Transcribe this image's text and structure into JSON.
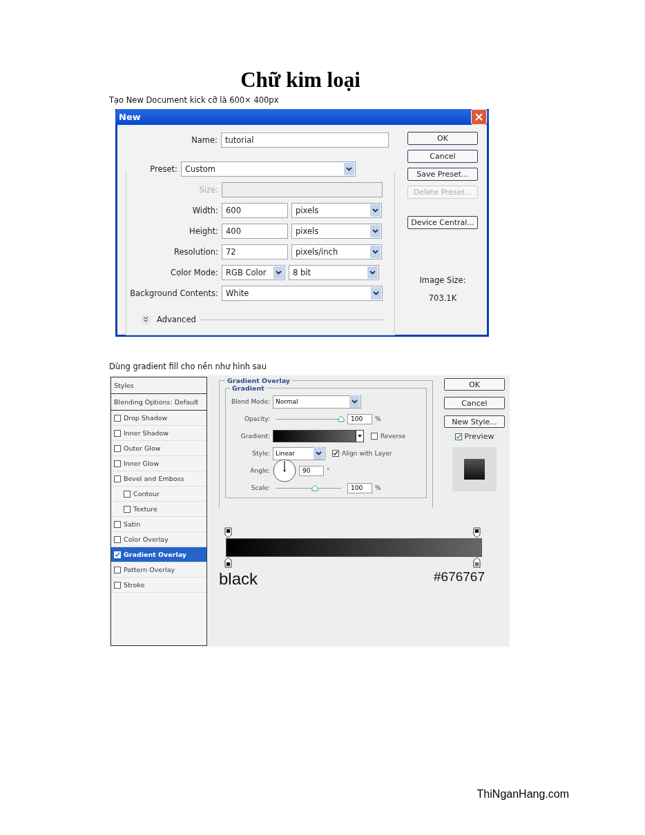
{
  "title": "Chữ kim loại",
  "caption_1": "Tạo New Document kick cỡ là 600× 400px",
  "new_dialog": {
    "title": "New",
    "fields": [
      {
        "kind": "text",
        "label": "Name:",
        "value": "tutorial",
        "disabled": false
      },
      {
        "kind": "select",
        "label": "Preset:",
        "value": "Custom",
        "disabled": false
      },
      {
        "kind": "select",
        "label": "Size:",
        "disabled": true
      },
      {
        "kind": "text_unit",
        "label": "Width:",
        "value": "600",
        "unit": "pixels",
        "disabled": false
      },
      {
        "kind": "text_unit",
        "label": "Height:",
        "value": "400",
        "unit": "pixels",
        "disabled": false
      },
      {
        "kind": "text_unit",
        "label": "Resolution:",
        "value": "72",
        "unit": "pixels/inch",
        "disabled": false
      },
      {
        "kind": "select_pair",
        "label": "Color Mode:",
        "value": "RGB Color",
        "unit": "8 bit",
        "disabled": false
      },
      {
        "kind": "select",
        "label": "Background Contents:",
        "value": "White",
        "disabled": false
      }
    ],
    "advanced": {
      "label": "Advanced",
      "expanded": false
    },
    "buttons": [
      {
        "label": "OK",
        "disabled": false
      },
      {
        "label": "Cancel",
        "disabled": false
      },
      {
        "label": "Save Preset...",
        "disabled": false
      },
      {
        "label": "Delete Preset...",
        "disabled": true
      },
      {
        "label": "Device Central...",
        "disabled": false
      }
    ],
    "image_size": {
      "label": "Image Size:",
      "value": "703.1K"
    }
  },
  "caption_2": "Dùng gradient fill cho nền như hình sau",
  "layer_style": {
    "styles": [
      {
        "kind": "header",
        "label": "Styles",
        "selected": false
      },
      {
        "kind": "header",
        "label": "Blending Options: Default",
        "selected": false
      },
      {
        "kind": "effect",
        "label": "Drop Shadow",
        "checked": false,
        "selected": false
      },
      {
        "kind": "effect",
        "label": "Inner Shadow",
        "checked": false,
        "selected": false
      },
      {
        "kind": "effect",
        "label": "Outer Glow",
        "checked": false,
        "selected": false
      },
      {
        "kind": "effect",
        "label": "Inner Glow",
        "checked": false,
        "selected": false
      },
      {
        "kind": "effect",
        "label": "Bevel and Emboss",
        "checked": false,
        "selected": false,
        "children": [
          {
            "kind": "effect",
            "label": "Contour",
            "checked": false,
            "selected": false
          },
          {
            "kind": "effect",
            "label": "Texture",
            "checked": false,
            "selected": false
          }
        ]
      },
      {
        "kind": "effect",
        "label": "Satin",
        "checked": false,
        "selected": false
      },
      {
        "kind": "effect",
        "label": "Color Overlay",
        "checked": false,
        "selected": false
      },
      {
        "kind": "effect",
        "label": "Gradient Overlay",
        "checked": true,
        "selected": true
      },
      {
        "kind": "effect",
        "label": "Pattern Overlay",
        "checked": false,
        "selected": false
      },
      {
        "kind": "effect",
        "label": "Stroke",
        "checked": false,
        "selected": false
      }
    ],
    "section": "Gradient Overlay",
    "subsection": "Gradient",
    "blend_mode": {
      "label": "Blend Mode:",
      "value": "Normal"
    },
    "opacity": {
      "label": "Opacity:",
      "level": 1,
      "value": "100",
      "unit": "%"
    },
    "gradient": {
      "label": "Gradient:",
      "reverse": {
        "label": "Reverse",
        "checked": false
      }
    },
    "style": {
      "label": "Style:",
      "value": "Linear",
      "align": {
        "label": "Align with Layer",
        "checked": true
      }
    },
    "angle": {
      "label": "Angle:",
      "value": "90",
      "unit": "°"
    },
    "scale": {
      "label": "Scale:",
      "level": 0.6,
      "value": "100",
      "unit": "%"
    },
    "buttons": [
      "OK",
      "Cancel",
      "New Style..."
    ],
    "preview": {
      "label": "Preview",
      "checked": true
    },
    "stops": [
      {
        "label": "black",
        "color": "#000000"
      },
      {
        "label": "#676767",
        "color": "#676767"
      }
    ]
  },
  "footer": "ThiNganHang.com"
}
